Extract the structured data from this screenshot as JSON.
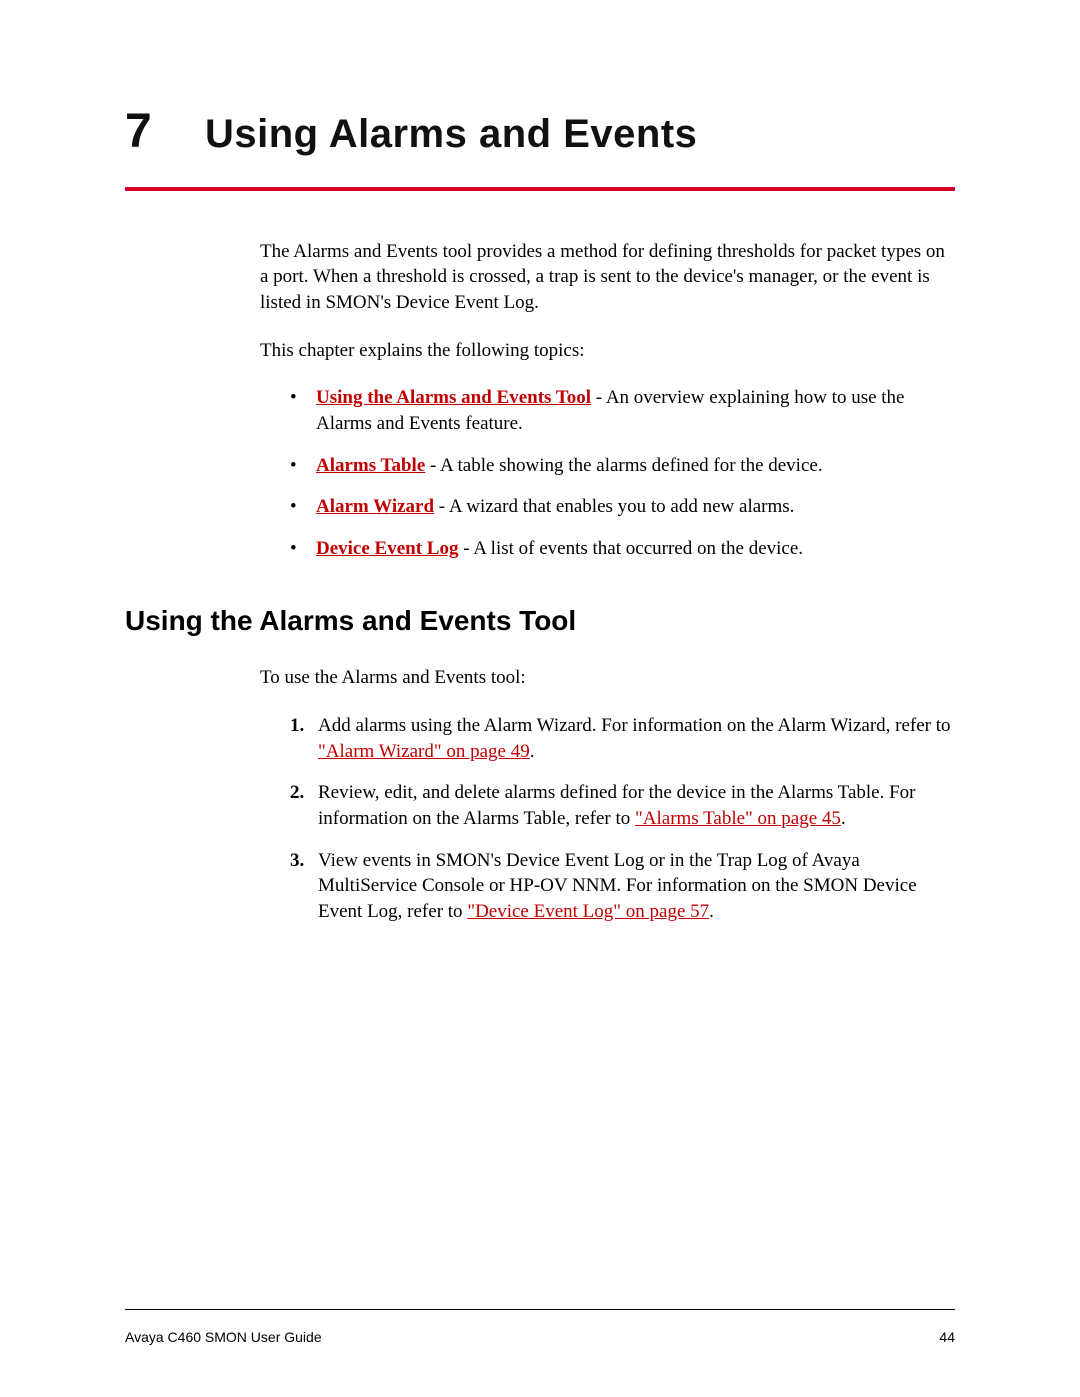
{
  "chapter": {
    "number": "7",
    "title": "Using Alarms and Events"
  },
  "intro": {
    "para1": "The Alarms and Events tool provides a method for defining thresholds for packet types on a port. When a threshold is crossed, a trap is sent to the device's manager, or the event is listed in SMON's Device Event Log.",
    "para2": "This chapter explains the following topics:"
  },
  "topics": [
    {
      "link": "Using the Alarms and Events Tool",
      "tail": " - An overview explaining how to use the Alarms and Events feature."
    },
    {
      "link": "Alarms Table",
      "tail": " - A table showing the alarms defined for the device."
    },
    {
      "link": "Alarm Wizard",
      "tail": " - A wizard that enables you to add new alarms."
    },
    {
      "link": "Device Event Log",
      "tail": " - A list of events that occurred on the device."
    }
  ],
  "section": {
    "title": "Using the Alarms and Events Tool",
    "lead": "To use the Alarms and Events tool:"
  },
  "steps": [
    {
      "pre": "Add alarms using the Alarm Wizard. For information on the Alarm Wizard, refer to ",
      "ref": "\"Alarm Wizard\" on page 49",
      "post": "."
    },
    {
      "pre": "Review, edit, and delete alarms defined for the device in the Alarms Table. For information on the Alarms Table, refer to ",
      "ref": "\"Alarms Table\" on page 45",
      "post": "."
    },
    {
      "pre": "View events in SMON's Device Event Log or in the Trap Log of Avaya MultiService Console or HP-OV NNM. For information on the SMON Device Event Log, refer to ",
      "ref": "\"Device Event Log\" on page 57",
      "post": "."
    }
  ],
  "footer": {
    "left": "Avaya C460 SMON User Guide",
    "right": "44"
  }
}
